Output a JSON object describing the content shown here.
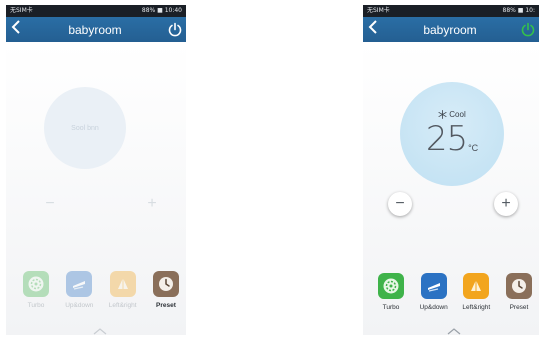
{
  "screens": [
    {
      "id": "left",
      "statusbar": {
        "carrier": "无SIM卡",
        "right": "88% ■ 10:40"
      },
      "title": "babyroom",
      "dial_message": "Sool bnn",
      "minus": "−",
      "plus": "+",
      "modes": [
        {
          "label": "Turbo",
          "icon": "turbo-icon",
          "color": "#3fb34a"
        },
        {
          "label": "Up&down",
          "icon": "updown-icon",
          "color": "#2b72c3"
        },
        {
          "label": "Left&right",
          "icon": "leftright-icon",
          "color": "#f2a51e"
        },
        {
          "label": "Preset",
          "icon": "clock-icon",
          "color": "#8a6f5a"
        }
      ]
    },
    {
      "id": "right",
      "statusbar": {
        "carrier": "无SIM卡",
        "right": "88% ■ 10:"
      },
      "title": "babyroom",
      "mode_label": "Cool",
      "temperature": "25",
      "unit": "°C",
      "minus": "−",
      "plus": "+",
      "modes": [
        {
          "label": "Turbo",
          "icon": "turbo-icon",
          "color": "#3fb34a"
        },
        {
          "label": "Up&down",
          "icon": "updown-icon",
          "color": "#2b72c3"
        },
        {
          "label": "Left&right",
          "icon": "leftright-icon",
          "color": "#f2a51e"
        },
        {
          "label": "Preset",
          "icon": "clock-icon",
          "color": "#8a6f5a"
        }
      ]
    }
  ],
  "colors": {
    "titlebar": "#2a6ea5",
    "statusbar": "#1a1f26",
    "power_off": "#ffffff",
    "power_on": "#35c24a"
  }
}
